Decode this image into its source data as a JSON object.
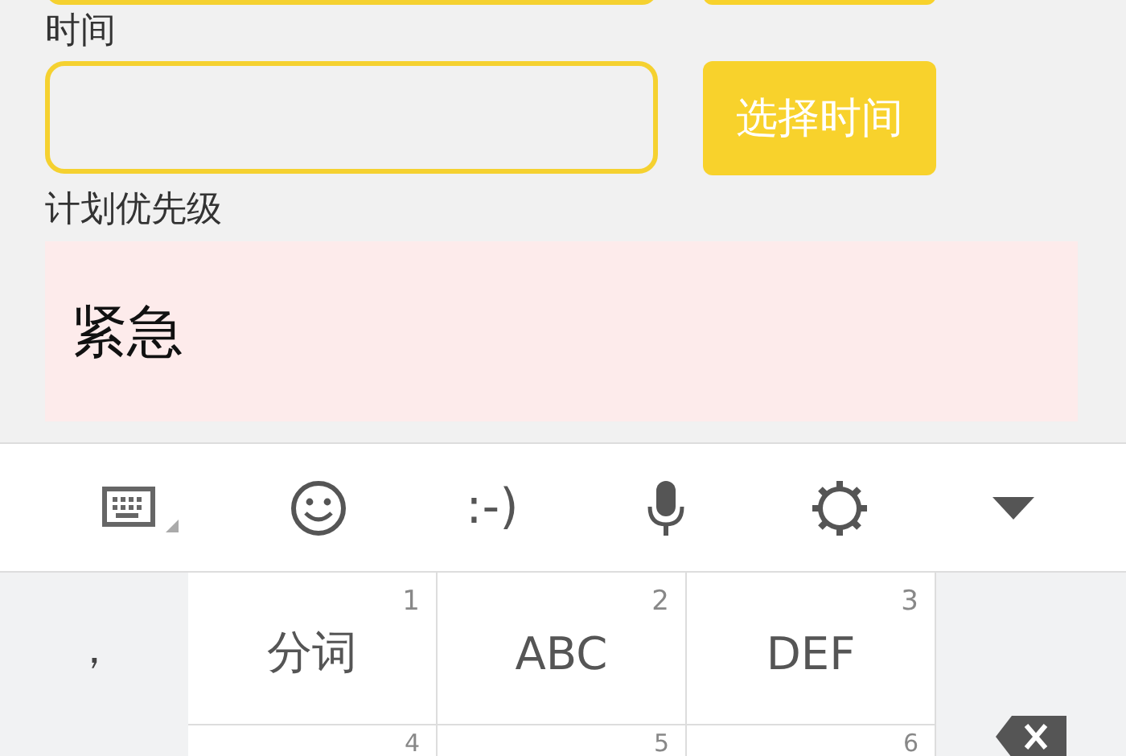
{
  "form": {
    "time": {
      "label": "时间",
      "button": "选择时间"
    },
    "priority": {
      "label": "计划优先级",
      "value": "紧急"
    }
  },
  "keyboard": {
    "toolbar": {
      "emoticon": ":-)"
    },
    "side_key": "，",
    "rows": [
      [
        {
          "label": "分词",
          "number": "1"
        },
        {
          "label": "ABC",
          "number": "2"
        },
        {
          "label": "DEF",
          "number": "3"
        }
      ],
      [
        {
          "number": "4"
        },
        {
          "number": "5"
        },
        {
          "number": "6"
        }
      ]
    ]
  }
}
